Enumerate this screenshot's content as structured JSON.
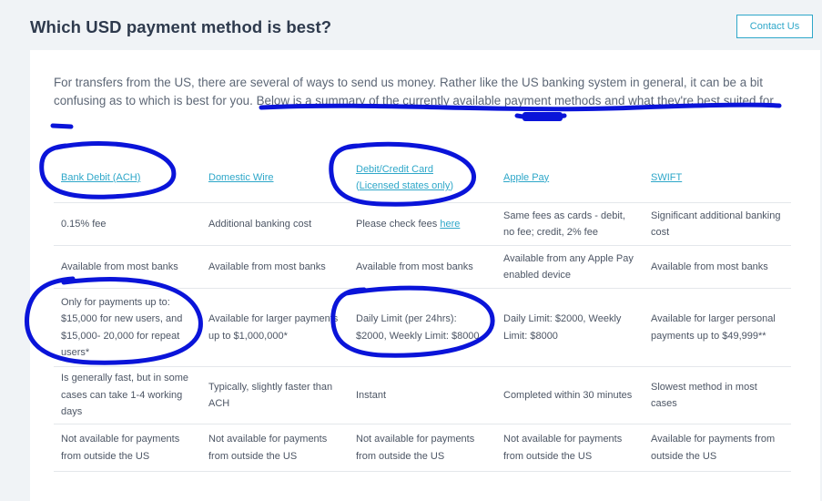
{
  "header": {
    "title": "Which USD payment method is best?",
    "contact_label": "Contact Us"
  },
  "intro": {
    "text_before": "For transfers from the US, there are several of ways to send us money. Rather like the US banking system in general, it can be a bit confusing as to which is best for you. ",
    "text_highlighted": "Below is a summary of the currently available payment methods and what they're best suited for."
  },
  "table": {
    "columns": [
      {
        "label": "Bank Debit (ACH)"
      },
      {
        "label": "Domestic Wire"
      },
      {
        "label": "Debit/Credit Card",
        "sub_link": "Licensed states only"
      },
      {
        "label": "Apple Pay"
      },
      {
        "label": "SWIFT"
      }
    ],
    "rows": [
      [
        "0.15% fee",
        "Additional banking cost",
        "Please check fees ",
        "Same fees as cards - debit, no fee; credit, 2% fee",
        "Significant additional banking cost"
      ],
      [
        "Available from most banks",
        "Available from most banks",
        "Available from most banks",
        "Available from any Apple Pay enabled device",
        "Available from most banks"
      ],
      [
        "Only for payments up to: $15,000 for new users, and $15,000- 20,000 for repeat users*",
        "Available for larger payments up to $1,000,000*",
        "Daily Limit (per 24hrs): $2000, Weekly Limit: $8000",
        "Daily Limit: $2000, Weekly Limit: $8000",
        "Available for larger personal payments up to $49,999**"
      ],
      [
        "Is generally fast, but in some cases can take 1-4 working days",
        "Typically, slightly faster than ACH",
        "Instant",
        "Completed within 30 minutes",
        "Slowest method in most cases"
      ],
      [
        "Not available for payments from outside the US",
        "Not available for payments from outside the US",
        "Not available for payments from outside the US",
        "Not available for payments from outside the US",
        "Available for payments from outside the US"
      ]
    ],
    "fees_link": "here"
  },
  "colors": {
    "accent": "#2ea7c9",
    "annotation": "#0a14d9",
    "background": "#f0f3f6"
  }
}
